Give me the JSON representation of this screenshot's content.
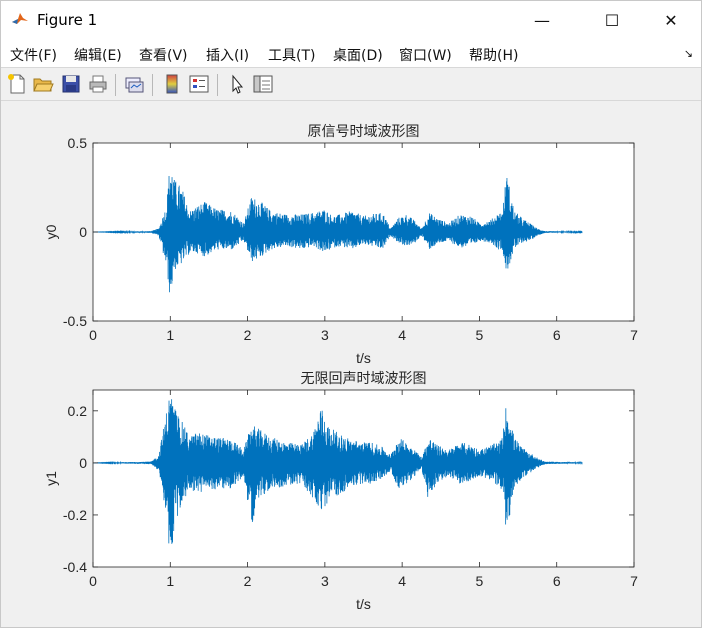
{
  "window": {
    "title": "Figure 1",
    "controls": {
      "minimize": "—",
      "maximize": "☐",
      "close": "✕"
    }
  },
  "menu": {
    "items": [
      "文件(F)",
      "编辑(E)",
      "查看(V)",
      "插入(I)",
      "工具(T)",
      "桌面(D)",
      "窗口(W)",
      "帮助(H)"
    ],
    "dock_arrow": "↘"
  },
  "toolbar": {
    "icons": [
      "new-figure-icon",
      "open-file-icon",
      "save-icon",
      "print-icon",
      "link-plot-icon",
      "colorbar-icon",
      "legend-icon",
      "pointer-icon",
      "property-inspector-icon"
    ]
  },
  "colors": {
    "line": "#0072bd"
  },
  "chart_data": [
    {
      "type": "line",
      "title": "原信号时域波形图",
      "xlabel": "t/s",
      "ylabel": "y0",
      "xlim": [
        0,
        7
      ],
      "ylim": [
        -0.5,
        0.5
      ],
      "xticks": [
        "0",
        "1",
        "2",
        "3",
        "4",
        "5",
        "6",
        "7"
      ],
      "yticks": [
        "0.5",
        "0",
        "-0.5"
      ],
      "grid": false,
      "envelope": {
        "t": [
          0,
          0.75,
          0.85,
          0.95,
          1.0,
          1.05,
          1.15,
          1.25,
          1.35,
          1.45,
          1.6,
          1.8,
          1.95,
          2.05,
          2.15,
          2.3,
          2.5,
          2.7,
          2.85,
          3.0,
          3.1,
          3.2,
          3.35,
          3.5,
          3.6,
          3.75,
          3.85,
          3.95,
          4.05,
          4.15,
          4.25,
          4.35,
          4.45,
          4.6,
          4.75,
          4.9,
          5.0,
          5.15,
          5.25,
          5.3,
          5.35,
          5.45,
          5.55,
          5.65,
          5.75,
          5.85,
          6.33
        ],
        "upper": [
          0,
          0.005,
          0.02,
          0.15,
          0.42,
          0.3,
          0.25,
          0.12,
          0.15,
          0.17,
          0.13,
          0.12,
          0.05,
          0.2,
          0.18,
          0.12,
          0.1,
          0.1,
          0.11,
          0.13,
          0.09,
          0.1,
          0.12,
          0.09,
          0.1,
          0.11,
          0.02,
          0.08,
          0.1,
          0.07,
          0.02,
          0.11,
          0.08,
          0.05,
          0.1,
          0.09,
          0.05,
          0.07,
          0.11,
          0.12,
          0.34,
          0.12,
          0.08,
          0.05,
          0.02,
          0.005,
          0.002
        ],
        "lower": [
          0,
          -0.005,
          -0.02,
          -0.2,
          -0.38,
          -0.22,
          -0.18,
          -0.12,
          -0.12,
          -0.14,
          -0.1,
          -0.1,
          -0.05,
          -0.17,
          -0.15,
          -0.1,
          -0.08,
          -0.1,
          -0.08,
          -0.12,
          -0.09,
          -0.08,
          -0.1,
          -0.07,
          -0.08,
          -0.1,
          -0.02,
          -0.06,
          -0.08,
          -0.07,
          -0.02,
          -0.1,
          -0.07,
          -0.05,
          -0.09,
          -0.08,
          -0.05,
          -0.06,
          -0.1,
          -0.1,
          -0.24,
          -0.1,
          -0.06,
          -0.05,
          -0.02,
          -0.005,
          -0.002
        ]
      }
    },
    {
      "type": "line",
      "title": "无限回声时域波形图",
      "xlabel": "t/s",
      "ylabel": "y1",
      "xlim": [
        0,
        7
      ],
      "ylim": [
        -0.4,
        0.28
      ],
      "xticks": [
        "0",
        "1",
        "2",
        "3",
        "4",
        "5",
        "6",
        "7"
      ],
      "yticks": [
        "0.2",
        "0",
        "-0.2",
        "-0.4"
      ],
      "grid": false,
      "envelope": {
        "t": [
          0,
          0.75,
          0.85,
          0.95,
          1.0,
          1.05,
          1.15,
          1.25,
          1.35,
          1.45,
          1.6,
          1.8,
          1.95,
          2.05,
          2.15,
          2.3,
          2.5,
          2.7,
          2.85,
          2.95,
          3.05,
          3.2,
          3.35,
          3.5,
          3.6,
          3.75,
          3.85,
          3.95,
          4.05,
          4.15,
          4.25,
          4.35,
          4.45,
          4.6,
          4.75,
          4.9,
          5.0,
          5.15,
          5.25,
          5.3,
          5.35,
          5.45,
          5.55,
          5.65,
          5.75,
          5.85,
          6.33
        ],
        "upper": [
          0,
          0.005,
          0.03,
          0.2,
          0.28,
          0.22,
          0.16,
          0.1,
          0.12,
          0.11,
          0.1,
          0.09,
          0.05,
          0.15,
          0.13,
          0.1,
          0.08,
          0.07,
          0.12,
          0.22,
          0.14,
          0.11,
          0.09,
          0.08,
          0.08,
          0.06,
          0.03,
          0.1,
          0.08,
          0.06,
          0.02,
          0.1,
          0.07,
          0.05,
          0.08,
          0.07,
          0.05,
          0.07,
          0.08,
          0.1,
          0.24,
          0.1,
          0.06,
          0.04,
          0.02,
          0.005,
          0.002
        ],
        "lower": [
          0,
          -0.005,
          -0.03,
          -0.2,
          -0.4,
          -0.26,
          -0.16,
          -0.1,
          -0.12,
          -0.11,
          -0.1,
          -0.1,
          -0.05,
          -0.24,
          -0.14,
          -0.1,
          -0.09,
          -0.08,
          -0.14,
          -0.22,
          -0.14,
          -0.12,
          -0.09,
          -0.08,
          -0.08,
          -0.06,
          -0.03,
          -0.1,
          -0.08,
          -0.06,
          -0.02,
          -0.16,
          -0.08,
          -0.05,
          -0.08,
          -0.07,
          -0.05,
          -0.07,
          -0.1,
          -0.1,
          -0.28,
          -0.1,
          -0.06,
          -0.04,
          -0.02,
          -0.005,
          -0.002
        ]
      }
    }
  ]
}
